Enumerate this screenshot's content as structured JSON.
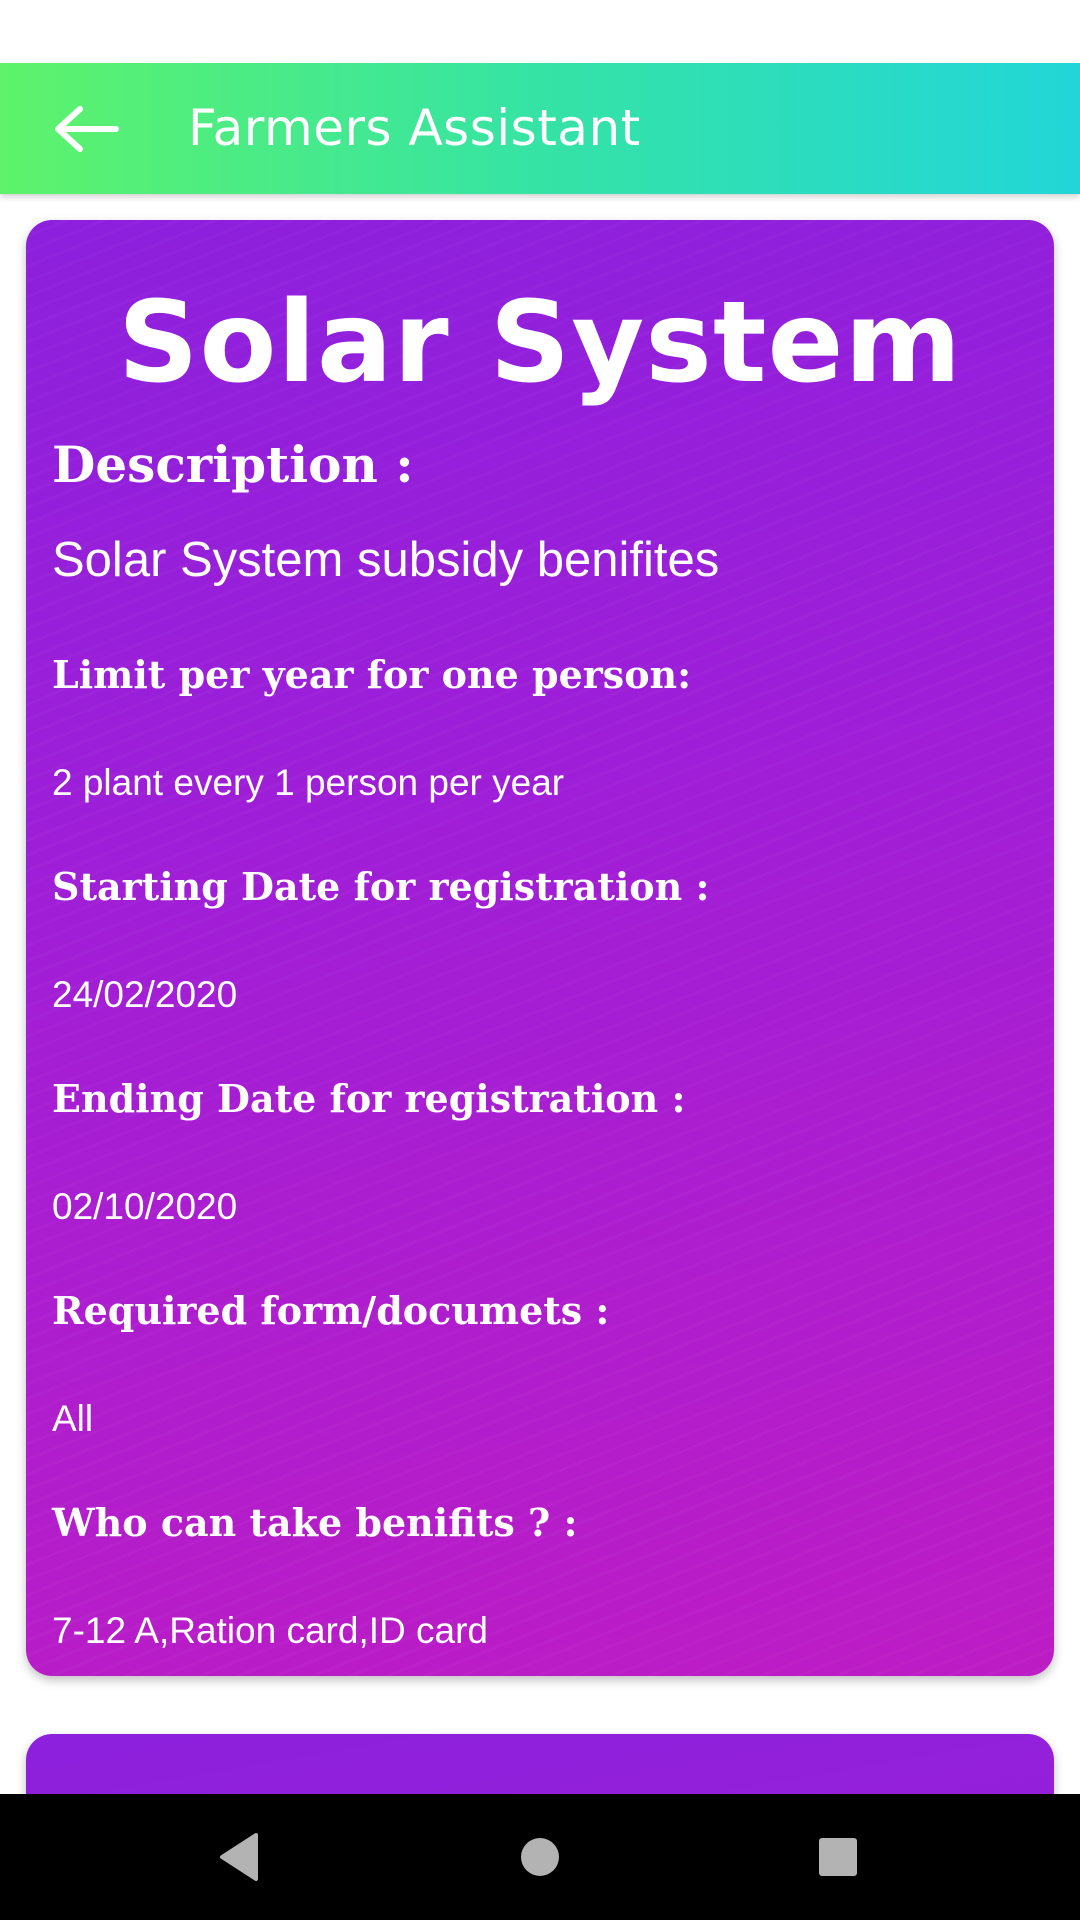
{
  "app_bar": {
    "title": "Farmers Assistant",
    "gradient": [
      "#5ef36a",
      "#22d6d8"
    ]
  },
  "card": {
    "title": "Solar System",
    "description_label": "Description :",
    "description_value": "Solar System subsidy benifites",
    "fields": [
      {
        "label": "Limit per year for one person:",
        "value": "2 plant every 1 person per year"
      },
      {
        "label": "Starting Date for registration :",
        "value": "24/02/2020"
      },
      {
        "label": "Ending Date for registration :",
        "value": "02/10/2020"
      },
      {
        "label": "Required form/documets :",
        "value": "All"
      },
      {
        "label": "Who can take benifits ? :",
        "value": "7-12 A,Ration card,ID card"
      }
    ],
    "gradient": [
      "#8c20dd",
      "#bd1cc4"
    ]
  },
  "icons": {
    "back": "arrow-left-icon",
    "nav_back": "triangle-back-icon",
    "nav_home": "circle-home-icon",
    "nav_recents": "square-recents-icon"
  }
}
